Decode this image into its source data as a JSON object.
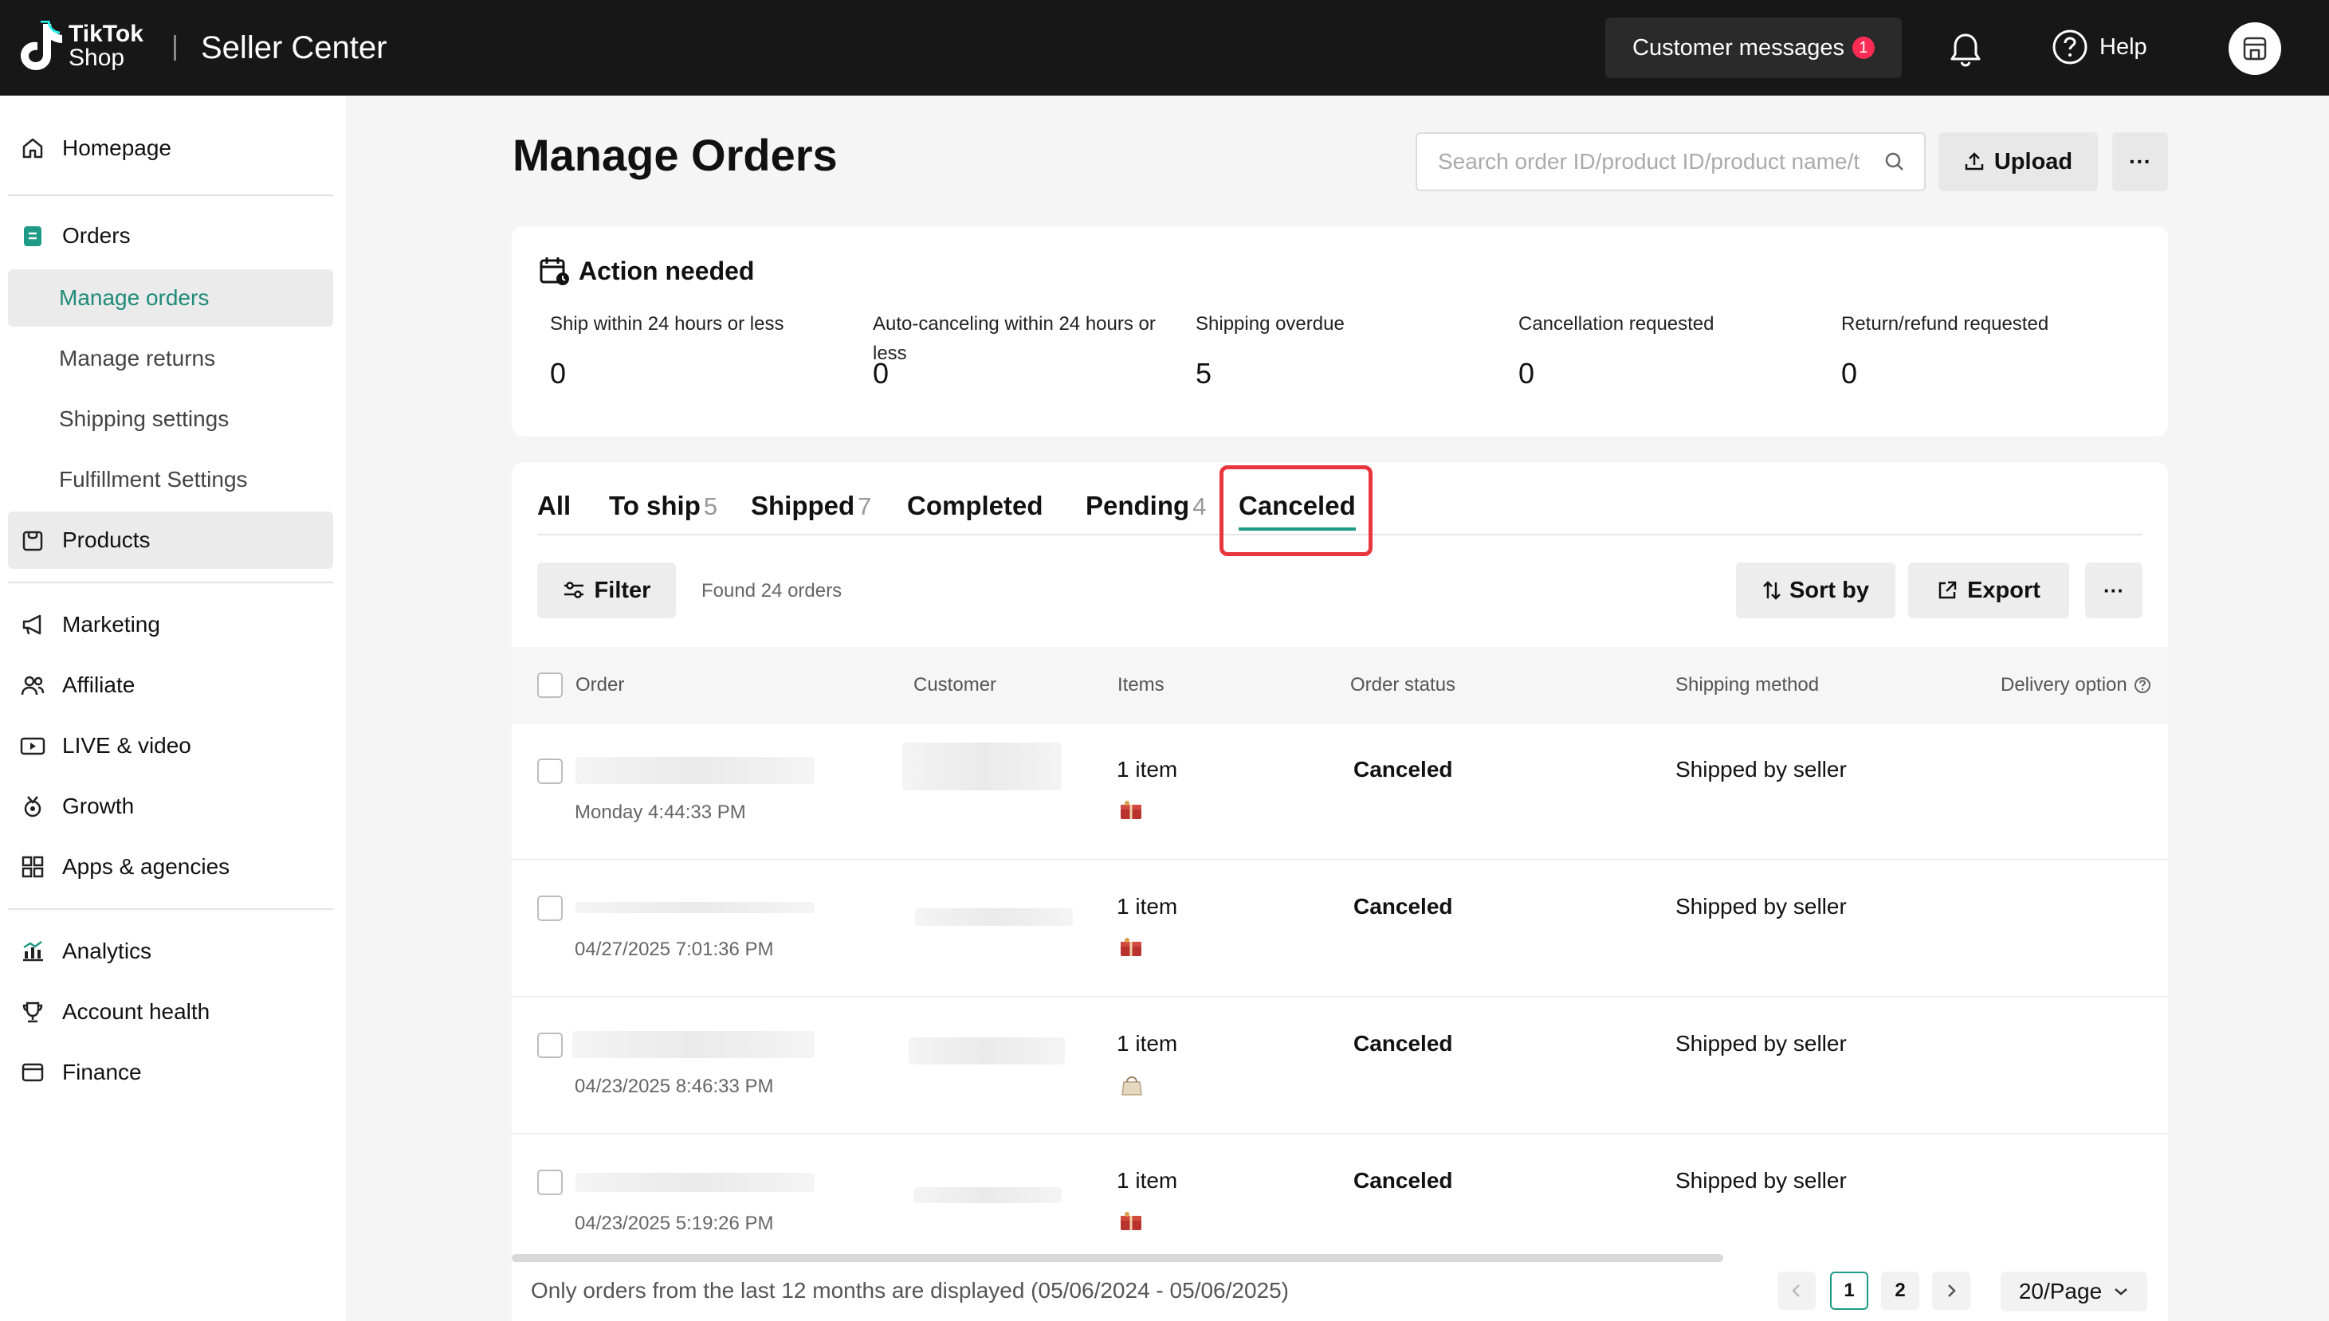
{
  "header": {
    "logo_line1": "TikTok",
    "logo_line2": "Shop",
    "title": "Seller Center",
    "customer_messages_label": "Customer messages",
    "customer_messages_count": "1",
    "help_label": "Help"
  },
  "sidebar": {
    "homepage": "Homepage",
    "orders": "Orders",
    "manage_orders": "Manage orders",
    "manage_returns": "Manage returns",
    "shipping_settings": "Shipping settings",
    "fulfillment_settings": "Fulfillment Settings",
    "products": "Products",
    "marketing": "Marketing",
    "affiliate": "Affiliate",
    "live_video": "LIVE & video",
    "growth": "Growth",
    "apps_agencies": "Apps & agencies",
    "analytics": "Analytics",
    "account_health": "Account health",
    "finance": "Finance"
  },
  "page": {
    "title": "Manage Orders",
    "search_placeholder": "Search order ID/product ID/product name/t",
    "upload_label": "Upload",
    "more_label": "···"
  },
  "action_needed": {
    "title": "Action needed",
    "metrics": [
      {
        "label": "Ship within 24 hours or less",
        "value": "0"
      },
      {
        "label": "Auto-canceling within 24 hours or less",
        "value": "0"
      },
      {
        "label": "Shipping overdue",
        "value": "5"
      },
      {
        "label": "Cancellation requested",
        "value": "0"
      },
      {
        "label": "Return/refund requested",
        "value": "0"
      }
    ]
  },
  "tabs": [
    {
      "label": "All",
      "count": ""
    },
    {
      "label": "To ship",
      "count": "5"
    },
    {
      "label": "Shipped",
      "count": "7"
    },
    {
      "label": "Completed",
      "count": ""
    },
    {
      "label": "Pending",
      "count": "4"
    },
    {
      "label": "Canceled",
      "count": ""
    }
  ],
  "toolbar": {
    "filter_label": "Filter",
    "found_text": "Found 24 orders",
    "sort_label": "Sort by",
    "export_label": "Export",
    "more_label": "···"
  },
  "table": {
    "headers": {
      "order": "Order",
      "customer": "Customer",
      "items": "Items",
      "status": "Order status",
      "shipping": "Shipping method",
      "delivery": "Delivery option"
    },
    "rows": [
      {
        "date": "Monday 4:44:33 PM",
        "items": "1 item",
        "status": "Canceled",
        "shipping": "Shipped by seller",
        "thumb": "red-gift-box"
      },
      {
        "date": "04/27/2025 7:01:36 PM",
        "items": "1 item",
        "status": "Canceled",
        "shipping": "Shipped by seller",
        "thumb": "red-gift-box"
      },
      {
        "date": "04/23/2025 8:46:33 PM",
        "items": "1 item",
        "status": "Canceled",
        "shipping": "Shipped by seller",
        "thumb": "beige-bag"
      },
      {
        "date": "04/23/2025 5:19:26 PM",
        "items": "1 item",
        "status": "Canceled",
        "shipping": "Shipped by seller",
        "thumb": "red-gift-box"
      }
    ]
  },
  "footer": {
    "note": "Only orders from the last 12 months are displayed (05/06/2024 - 05/06/2025)",
    "page_1": "1",
    "page_2": "2",
    "page_size": "20/Page"
  },
  "colors": {
    "accent": "#1f9a86",
    "highlight_box": "#e8363e",
    "topbar": "#171717",
    "badge": "#fe2c55"
  }
}
